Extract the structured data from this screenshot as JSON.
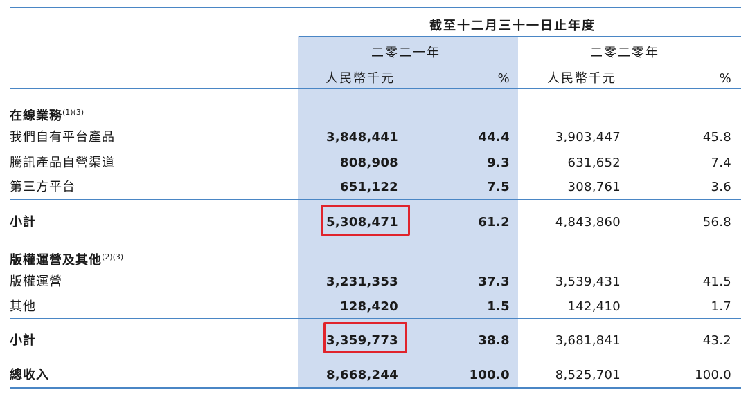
{
  "header": {
    "period_title": "截至十二月三十一日止年度",
    "year_2021": "二零二一年",
    "year_2020": "二零二零年",
    "unit_2021": "人民幣千元",
    "pct_2021": "%",
    "unit_2020": "人民幣千元",
    "pct_2020": "%"
  },
  "sections": {
    "online": {
      "title": "在線業務",
      "footnote": "(1)(3)",
      "rows": [
        {
          "label": "我們自有平台產品",
          "rmb_2021": "3,848,441",
          "pct_2021": "44.4",
          "rmb_2020": "3,903,447",
          "pct_2020": "45.8"
        },
        {
          "label": "騰訊產品自營渠道",
          "rmb_2021": "808,908",
          "pct_2021": "9.3",
          "rmb_2020": "631,652",
          "pct_2020": "7.4"
        },
        {
          "label": "第三方平台",
          "rmb_2021": "651,122",
          "pct_2021": "7.5",
          "rmb_2020": "308,761",
          "pct_2020": "3.6"
        }
      ],
      "subtotal": {
        "label": "小計",
        "rmb_2021": "5,308,471",
        "pct_2021": "61.2",
        "rmb_2020": "4,843,860",
        "pct_2020": "56.8"
      }
    },
    "copyright": {
      "title": "版權運營及其他",
      "footnote": "(2)(3)",
      "rows": [
        {
          "label": "版權運營",
          "rmb_2021": "3,231,353",
          "pct_2021": "37.3",
          "rmb_2020": "3,539,431",
          "pct_2020": "41.5"
        },
        {
          "label": "其他",
          "rmb_2021": "128,420",
          "pct_2021": "1.5",
          "rmb_2020": "142,410",
          "pct_2020": "1.7"
        }
      ],
      "subtotal": {
        "label": "小計",
        "rmb_2021": "3,359,773",
        "pct_2021": "38.8",
        "rmb_2020": "3,681,841",
        "pct_2020": "43.2"
      }
    }
  },
  "total": {
    "label": "總收入",
    "rmb_2021": "8,668,244",
    "pct_2021": "100.0",
    "rmb_2020": "8,525,701",
    "pct_2020": "100.0"
  },
  "colors": {
    "band": "#cfdcf0",
    "rule": "#4a86c5",
    "highlight_box": "#e0242c"
  }
}
